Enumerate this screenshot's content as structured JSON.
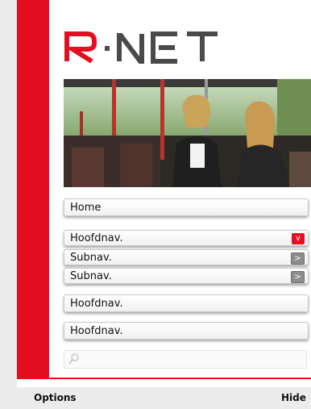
{
  "brand": {
    "logo_text": "R·NET",
    "colors": {
      "red": "#e30e1f",
      "gray": "#4a4a4a"
    }
  },
  "hero": {
    "icon": "photo-people-on-bus"
  },
  "menu": {
    "items": [
      {
        "label": "Home"
      },
      {
        "label": "Hoofdnav.",
        "badge": "v",
        "badge_style": "red"
      },
      {
        "label": "Subnav.",
        "badge": ">",
        "badge_style": "gray"
      },
      {
        "label": "Subnav.",
        "badge": ">",
        "badge_style": "gray"
      },
      {
        "label": "Hoofdnav."
      },
      {
        "label": "Hoofdnav."
      }
    ]
  },
  "search": {
    "placeholder": "",
    "icon": "magnifier-icon"
  },
  "softkeys": {
    "left": "Options",
    "right": "Hide"
  }
}
